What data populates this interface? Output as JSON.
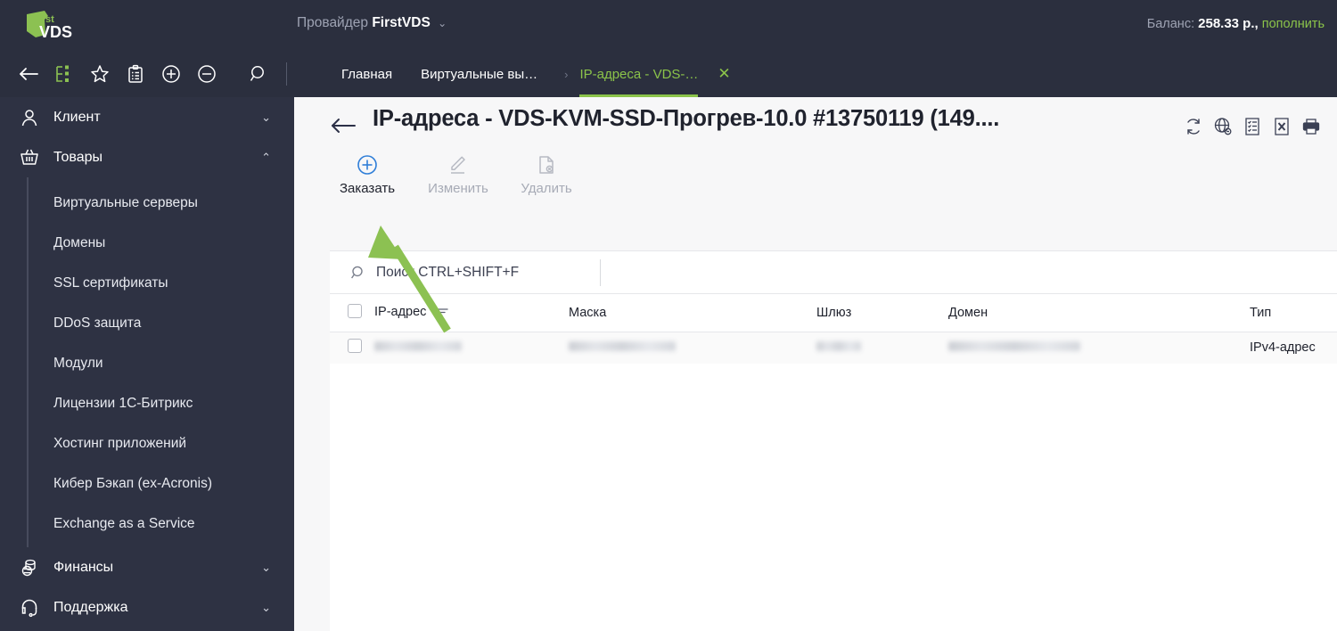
{
  "topbar": {
    "logo_alt": "1stVDS",
    "provider_prefix": "Провайдер",
    "provider_name": "FirstVDS",
    "provider_chevron": "⌄",
    "balance_label": "Баланс:",
    "balance_amount": "258.33 р.,",
    "balance_refill": "пополнить"
  },
  "iconbar": {
    "items": [
      {
        "name": "back-icon",
        "label": "Назад"
      },
      {
        "name": "tree-icon",
        "label": "Структура"
      },
      {
        "name": "star-icon",
        "label": "Избранное"
      },
      {
        "name": "clipboard-icon",
        "label": "Задачи"
      },
      {
        "name": "plus-circle-icon",
        "label": "Развернуть"
      },
      {
        "name": "minus-circle-icon",
        "label": "Свернуть"
      },
      {
        "name": "search-icon",
        "label": "Поиск"
      }
    ]
  },
  "tabs": {
    "items": [
      {
        "label": "Главная",
        "active": false
      },
      {
        "label": "Виртуальные вы…",
        "active": false
      }
    ],
    "separator": "›",
    "active_tab": "IP-адреса - VDS-…",
    "close_glyph": "✕"
  },
  "sidebar": {
    "groups": [
      {
        "label": "Клиент",
        "icon": "user-icon",
        "chevron": "⌄",
        "expanded": false
      },
      {
        "label": "Товары",
        "icon": "basket-icon",
        "chevron": "⌃",
        "expanded": true
      }
    ],
    "products_items": [
      "Виртуальные серверы",
      "Домены",
      "SSL сертификаты",
      "DDoS защита",
      "Модули",
      "Лицензии 1С-Битрикс",
      "Хостинг приложений",
      "Кибер Бэкап (ex-Acronis)",
      "Exchange as a Service"
    ],
    "bottom_groups": [
      {
        "label": "Финансы",
        "icon": "coins-icon",
        "chevron": "⌄"
      },
      {
        "label": "Поддержка",
        "icon": "headset-icon",
        "chevron": "⌄"
      }
    ]
  },
  "page": {
    "back_arrow": "←",
    "title": "IP-адреса - VDS-KVM-SSD-Прогрев-10.0 #13750119 (149....",
    "head_icons": [
      {
        "name": "refresh-icon"
      },
      {
        "name": "globe-link-icon"
      },
      {
        "name": "report-icon"
      },
      {
        "name": "excel-export-icon"
      },
      {
        "name": "print-icon"
      }
    ]
  },
  "toolbar": {
    "order_label": "Заказать",
    "edit_label": "Изменить",
    "delete_label": "Удалить"
  },
  "search": {
    "placeholder": "Поиск CTRL+SHIFT+F",
    "value": ""
  },
  "table": {
    "columns": [
      "IP-адрес",
      "Маска",
      "Шлюз",
      "Домен",
      "Тип"
    ],
    "rows": [
      {
        "selected": false,
        "ip": "",
        "ip_redacted": true,
        "mask": "",
        "mask_redacted": true,
        "gateway": "",
        "gateway_redacted": true,
        "domain": "",
        "domain_redacted": true,
        "type": "IPv4-адрес"
      }
    ]
  },
  "annotation": {
    "arrow_color": "#8cc152",
    "points_at": "Заказать"
  },
  "colors": {
    "header_bg": "#2b2f3e",
    "sidebar_bg": "#2e3243",
    "accent_green": "#8bc34a",
    "accent_blue": "#2f7ed8",
    "content_bg": "#f7f7f8"
  }
}
